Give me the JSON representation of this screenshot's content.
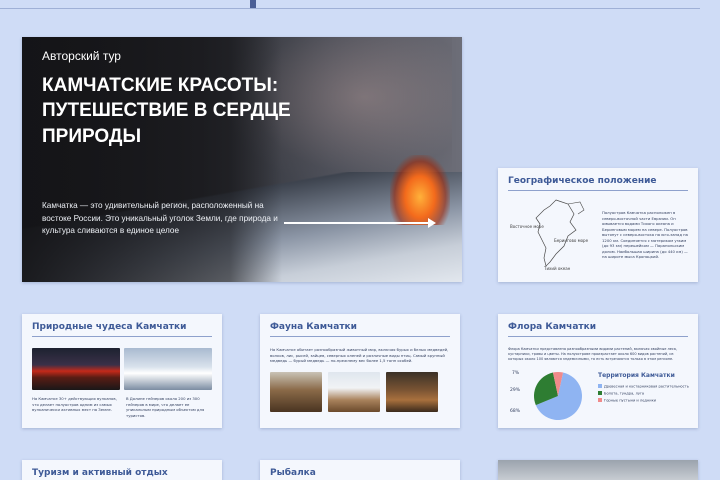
{
  "hero": {
    "eyebrow": "Авторский тур",
    "headline": "КАМЧАТСКИЕ КРАСОТЫ: ПУТЕШЕСТВИЕ В СЕРДЦЕ ПРИРОДЫ",
    "lead": "Камчатка — это удивительный регион, расположенный на востоке России. Это уникальный уголок Земли, где природа и культура сливаются в единое целое"
  },
  "geo": {
    "title": "Географическое положение",
    "label_bering": "Берингово море",
    "label_east_sea": "Восточное море",
    "label_pacific": "Тихий океан",
    "desc": "Полуостров Камчатка расположен в северо-восточной части Евразии. Он омывается водами Тихого океана и Беринговым морем на севере. Полуостров вытянут с северо-востока на юго-запад на 1200 км. Соединяется с материком узким (до 93 км) перешейком — Парапольским долом. Наибольшая ширина (до 440 км) — на широте мыса Кроноцкий."
  },
  "wonders": {
    "title": "Природные чудеса Камчатки",
    "caption_left": "На Камчатке 30+ действующих вулканов, что делает полуостров одним из самых вулканически активных мест на Земле.",
    "caption_right": "В Долине гейзеров около 200 из 300 гейзеров в мире, что делает ее уникальным природным объектом для туристов."
  },
  "fauna": {
    "title": "Фауна Камчатки",
    "intro": "На Камчатке обитает разнообразный животный мир, включая бурых и белых медведей, волков, лис, рысей, зайцев, северных оленей и различные виды птиц. Самый крупный медведь — бурый медведь — по-прежнему вес более 1,5 тонн особей."
  },
  "flora": {
    "title": "Флора  Камчатки",
    "intro": "Флора Камчатки представлена разнообразными видами растений, включая хвойные леса, кустарники, травы и цветы. На полуострове произрастает около 600 видов растений, из которых около 100 являются эндемичными, то есть встречаются только в этом регионе.",
    "legend_title": "Территория Камчатки",
    "labels": [
      "7%",
      "29%",
      "68%"
    ]
  },
  "chart_data": {
    "type": "pie",
    "title": "Территория Камчатки",
    "categories": [
      "Древесная и кустарниковая растительность",
      "Болота, тундра, луга",
      "Горные пустыни и ледники"
    ],
    "values": [
      68,
      29,
      7
    ],
    "colors": [
      "#8fb4f2",
      "#2e7d32",
      "#f08a8a"
    ]
  },
  "tourism": {
    "title": "Туризм и активный отдых"
  },
  "fishing": {
    "title": "Рыбалка"
  }
}
